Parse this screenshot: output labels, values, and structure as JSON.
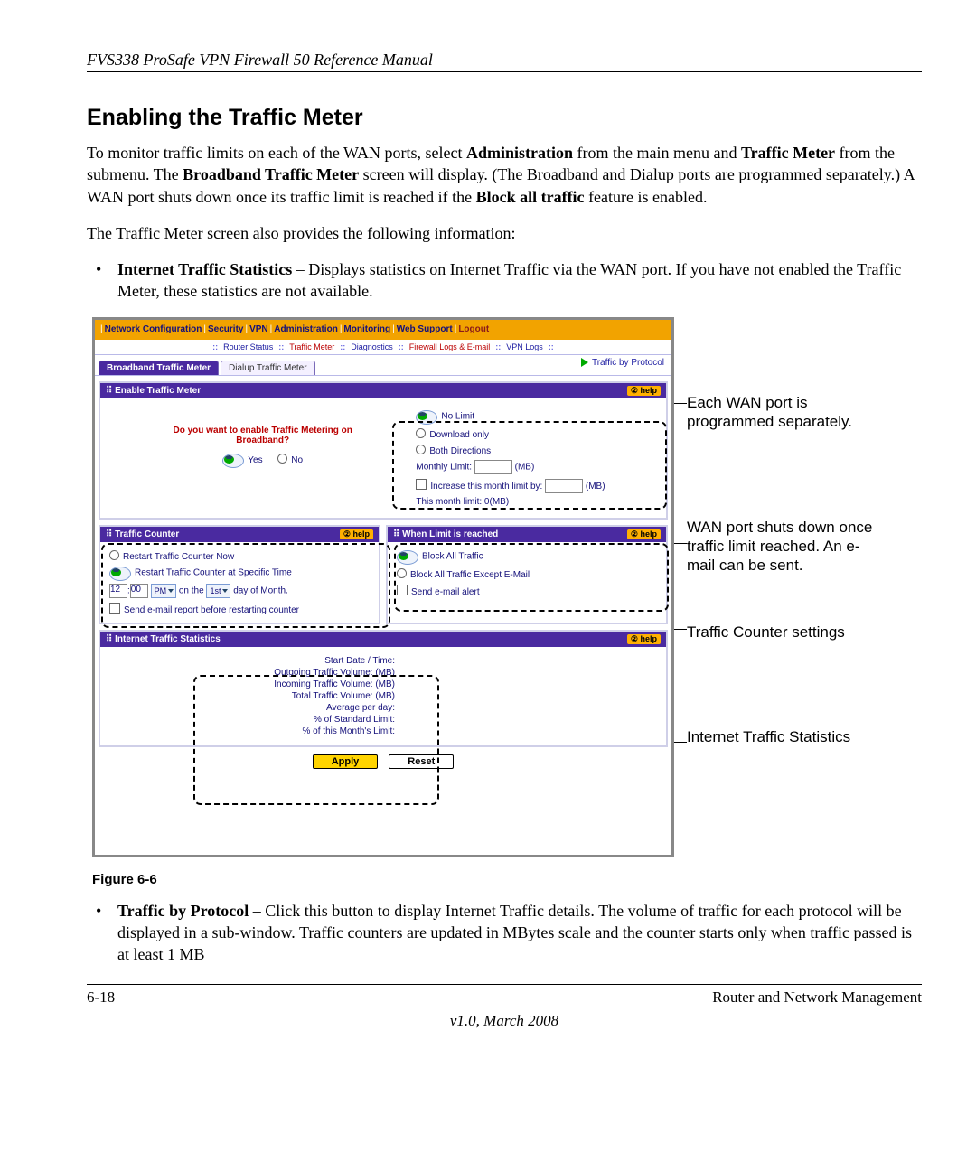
{
  "doc": {
    "header": "FVS338 ProSafe VPN Firewall 50 Reference Manual",
    "title": "Enabling the Traffic Meter",
    "p1_a": "To monitor traffic limits on each of the WAN ports, select ",
    "p1_b": "Administration",
    "p1_c": " from the main menu and ",
    "p1_d": "Traffic Meter",
    "p1_e": " from the submenu. The ",
    "p1_f": "Broadband Traffic Meter",
    "p1_g": " screen will display. (The Broadband and Dialup ports are programmed separately.) A WAN port shuts down once its traffic limit is reached if the ",
    "p1_h": "Block all traffic",
    "p1_i": " feature is enabled.",
    "p2": "The Traffic Meter screen also provides the following information:",
    "b1_a": "Internet Traffic Statistics",
    "b1_b": " – Displays statistics on Internet Traffic via the WAN port. If you have not enabled the Traffic Meter, these statistics are not available.",
    "figcap": "Figure 6-6",
    "b2_a": "Traffic by Protocol",
    "b2_b": " – Click this button to display Internet Traffic details. The volume of traffic for each protocol will be displayed in a sub-window. Traffic counters are updated in MBytes scale and the counter starts only when traffic passed is at least 1 MB",
    "pagenum": "6-18",
    "footer_r": "Router and Network Management",
    "version": "v1.0, March 2008"
  },
  "nav": {
    "items": [
      "Network Configuration",
      "Security",
      "VPN",
      "Administration",
      "Monitoring",
      "Web Support",
      "Logout"
    ],
    "sub": [
      "Router Status",
      "Traffic Meter",
      "Diagnostics",
      "Firewall Logs & E-mail",
      "VPN Logs"
    ]
  },
  "tabs": {
    "active": "Broadband Traffic Meter",
    "other": "Dialup Traffic Meter",
    "byproto": "Traffic by Protocol"
  },
  "enable": {
    "head": "Enable Traffic Meter",
    "q1": "Do you want to enable Traffic Metering on",
    "q2": "Broadband?",
    "yes": "Yes",
    "no": "No",
    "nolimit": "No Limit",
    "dl": "Download only",
    "both": "Both Directions",
    "mlimit": "Monthly Limit:",
    "mb": "(MB)",
    "inc": "Increase this month limit by:",
    "thismonth": "This month limit:  0(MB)"
  },
  "counter": {
    "head": "Traffic Counter",
    "r1": "Restart Traffic Counter Now",
    "r2": "Restart Traffic Counter at Specific Time",
    "hr": "12",
    "min": "00",
    "ampm": "PM",
    "on": "on the",
    "day": "1st",
    "dom": "day of Month.",
    "r4": "Send e-mail report before restarting counter"
  },
  "limit": {
    "head": "When Limit is reached",
    "o1": "Block All Traffic",
    "o2": "Block All Traffic Except E-Mail",
    "o3": "Send e-mail alert"
  },
  "stats": {
    "head": "Internet Traffic Statistics",
    "l1": "Start Date / Time:",
    "l2": "Outgoing Traffic Volume:  (MB)",
    "l3": "Incoming Traffic Volume:  (MB)",
    "l4": "Total Traffic Volume:  (MB)",
    "l5": "Average per day:",
    "l6": "% of Standard Limit:",
    "l7": "% of this Month's Limit:"
  },
  "btn": {
    "apply": "Apply",
    "reset": "Reset"
  },
  "call": {
    "c1": "Each WAN port is programmed separately.",
    "c2": "WAN port shuts down once traffic limit reached. An e-mail can be sent.",
    "c3": "Traffic Counter settings",
    "c4": "Internet Traffic Statistics"
  },
  "help": "help"
}
